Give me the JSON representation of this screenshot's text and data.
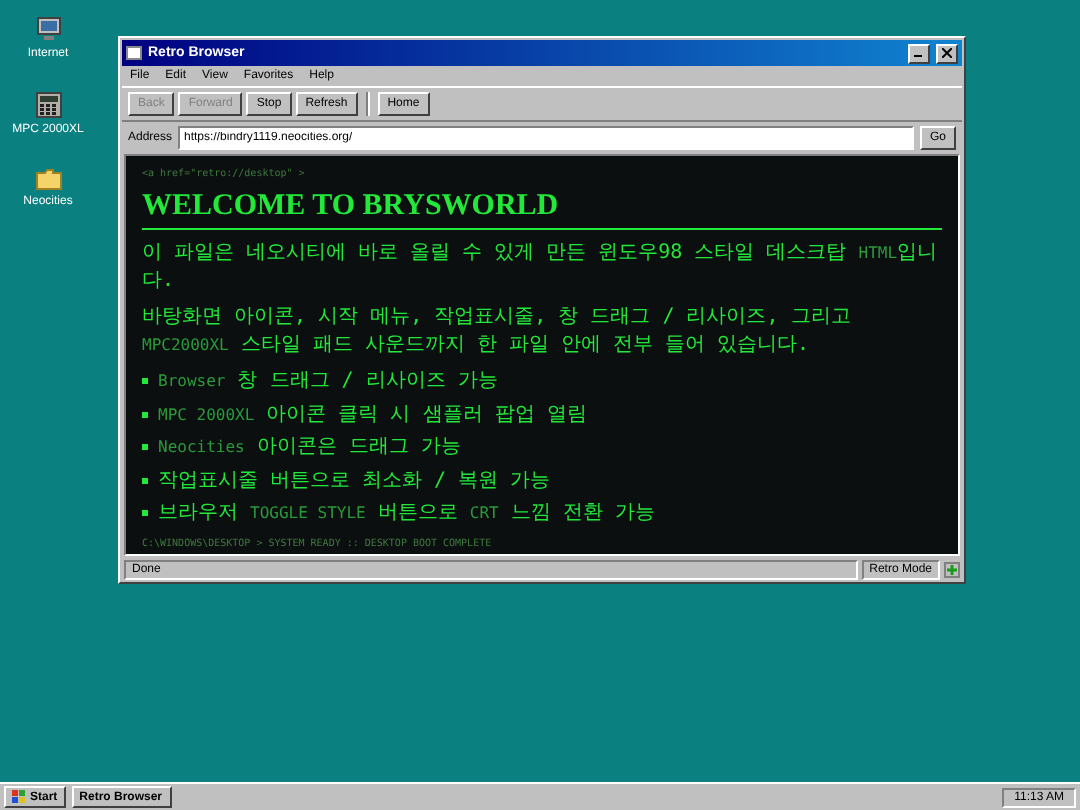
{
  "desktop_icons": [
    {
      "label": "Internet",
      "kind": "computer"
    },
    {
      "label": "MPC 2000XL",
      "kind": "sampler"
    },
    {
      "label": "Neocities",
      "kind": "folder"
    }
  ],
  "window": {
    "title": "Retro Browser",
    "menu": [
      "File",
      "Edit",
      "View",
      "Favorites",
      "Help"
    ],
    "toolbar": [
      {
        "label": "Back",
        "disabled": true
      },
      {
        "label": "Forward",
        "disabled": true
      },
      {
        "label": "Stop",
        "disabled": false
      },
      {
        "label": "Refresh",
        "disabled": false
      },
      {
        "label": "Home",
        "disabled": false
      }
    ],
    "address": {
      "label": "Address",
      "value": "https://bindry1119.neocities.org/",
      "go": "Go"
    },
    "content": {
      "comment": "<a href=\"retro://desktop\" >",
      "heading": "WELCOME TO BRYSWORLD",
      "paragraphs": [
        [
          {
            "kind": "text",
            "text": "이 파일은 네오시티에 바로 올릴 수 있게 만든 윈도우98 스타일 데스크탑 "
          },
          {
            "kind": "code",
            "text": "HTML"
          },
          {
            "kind": "text",
            "text": "입니다."
          }
        ],
        [
          {
            "kind": "text",
            "text": "바탕화면 아이콘, 시작 메뉴, 작업표시줄, 창 드래그 / 리사이즈, 그리고 "
          },
          {
            "kind": "code",
            "text": "MPC2000XL"
          },
          {
            "kind": "text",
            "text": " 스타일 패드 사운드까지 한 파일 안에 전부 들어 있습니다."
          }
        ]
      ],
      "bullets": [
        [
          {
            "kind": "code",
            "text": "Browser"
          },
          {
            "kind": "text",
            "text": " 창 드래그 / 리사이즈 가능"
          }
        ],
        [
          {
            "kind": "code",
            "text": "MPC 2000XL"
          },
          {
            "kind": "text",
            "text": " 아이콘 클릭 시 샘플러 팝업 열림"
          }
        ],
        [
          {
            "kind": "code",
            "text": "Neocities"
          },
          {
            "kind": "text",
            "text": " 아이콘은 드래그 가능"
          }
        ],
        [
          {
            "kind": "text",
            "text": "작업표시줄 버튼으로 최소화 / 복원 가능"
          }
        ],
        [
          {
            "kind": "text",
            "text": "브라우저 "
          },
          {
            "kind": "code",
            "text": "TOGGLE STYLE"
          },
          {
            "kind": "text",
            "text": " 버튼으로 "
          },
          {
            "kind": "code",
            "text": "CRT"
          },
          {
            "kind": "text",
            "text": " 느낌 전환 가능"
          }
        ]
      ],
      "footer": "C:\\WINDOWS\\DESKTOP > SYSTEM READY :: DESKTOP BOOT COMPLETE"
    },
    "status_bar": {
      "text": "Done",
      "mode": "Retro Mode"
    }
  },
  "taskbar": {
    "start": "Start",
    "tasks": [
      {
        "label": "Retro Browser",
        "selected": false
      }
    ],
    "clock": "11:13 AM"
  }
}
